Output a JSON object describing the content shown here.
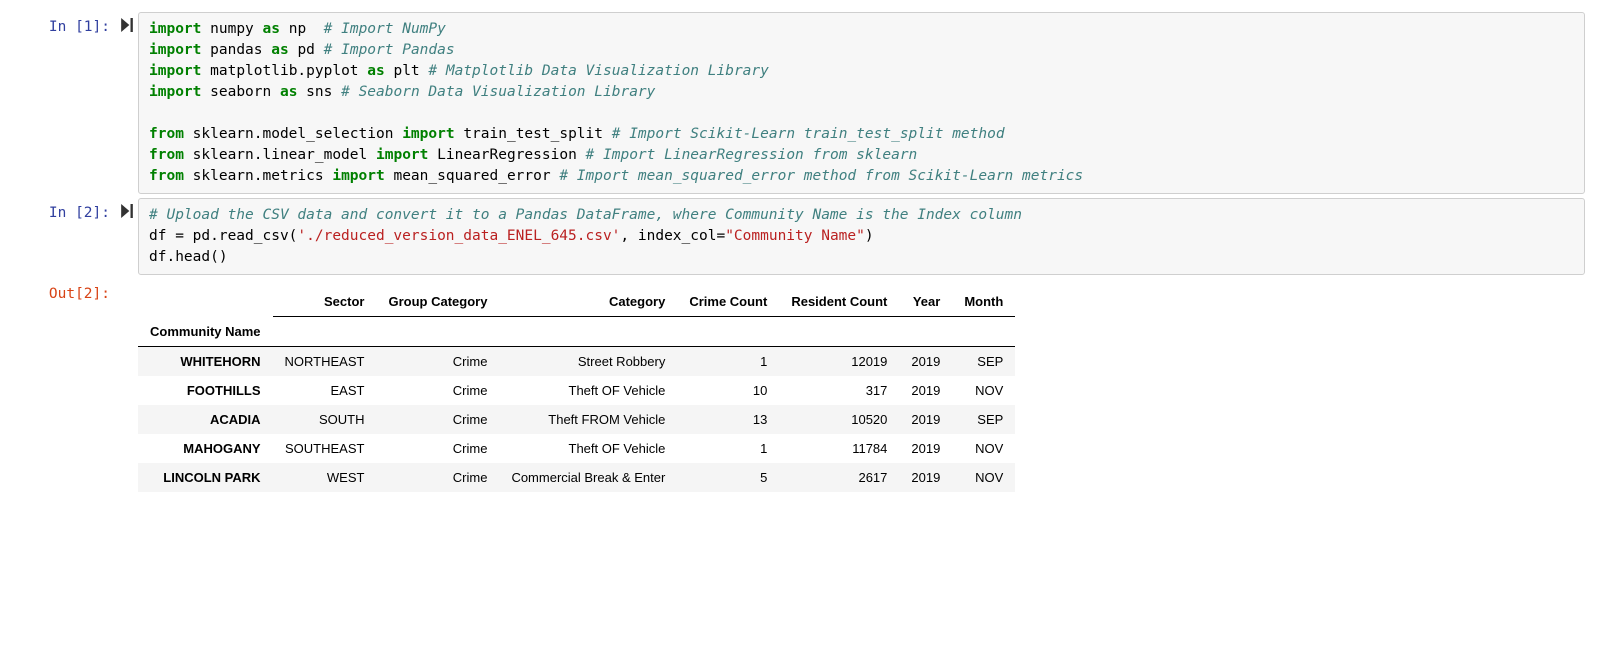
{
  "cells": [
    {
      "prompt_in": "In [1]:",
      "tokens": [
        [
          [
            "kw",
            "import"
          ],
          [
            "sp",
            " "
          ],
          [
            "name",
            "numpy"
          ],
          [
            "sp",
            " "
          ],
          [
            "kw",
            "as"
          ],
          [
            "sp",
            " "
          ],
          [
            "name",
            "np"
          ],
          [
            "sp",
            "  "
          ],
          [
            "cmt",
            "# Import NumPy"
          ]
        ],
        [
          [
            "kw",
            "import"
          ],
          [
            "sp",
            " "
          ],
          [
            "name",
            "pandas"
          ],
          [
            "sp",
            " "
          ],
          [
            "kw",
            "as"
          ],
          [
            "sp",
            " "
          ],
          [
            "name",
            "pd"
          ],
          [
            "sp",
            " "
          ],
          [
            "cmt",
            "# Import Pandas"
          ]
        ],
        [
          [
            "kw",
            "import"
          ],
          [
            "sp",
            " "
          ],
          [
            "name",
            "matplotlib.pyplot"
          ],
          [
            "sp",
            " "
          ],
          [
            "kw",
            "as"
          ],
          [
            "sp",
            " "
          ],
          [
            "name",
            "plt"
          ],
          [
            "sp",
            " "
          ],
          [
            "cmt",
            "# Matplotlib Data Visualization Library"
          ]
        ],
        [
          [
            "kw",
            "import"
          ],
          [
            "sp",
            " "
          ],
          [
            "name",
            "seaborn"
          ],
          [
            "sp",
            " "
          ],
          [
            "kw",
            "as"
          ],
          [
            "sp",
            " "
          ],
          [
            "name",
            "sns"
          ],
          [
            "sp",
            " "
          ],
          [
            "cmt",
            "# Seaborn Data Visualization Library"
          ]
        ],
        [],
        [
          [
            "kw",
            "from"
          ],
          [
            "sp",
            " "
          ],
          [
            "name",
            "sklearn.model_selection"
          ],
          [
            "sp",
            " "
          ],
          [
            "kw",
            "import"
          ],
          [
            "sp",
            " "
          ],
          [
            "name",
            "train_test_split"
          ],
          [
            "sp",
            " "
          ],
          [
            "cmt",
            "# Import Scikit-Learn train_test_split method"
          ]
        ],
        [
          [
            "kw",
            "from"
          ],
          [
            "sp",
            " "
          ],
          [
            "name",
            "sklearn.linear_model"
          ],
          [
            "sp",
            " "
          ],
          [
            "kw",
            "import"
          ],
          [
            "sp",
            " "
          ],
          [
            "name",
            "LinearRegression"
          ],
          [
            "sp",
            " "
          ],
          [
            "cmt",
            "# Import LinearRegression from sklearn"
          ]
        ],
        [
          [
            "kw",
            "from"
          ],
          [
            "sp",
            " "
          ],
          [
            "name",
            "sklearn.metrics"
          ],
          [
            "sp",
            " "
          ],
          [
            "kw",
            "import"
          ],
          [
            "sp",
            " "
          ],
          [
            "name",
            "mean_squared_error"
          ],
          [
            "sp",
            " "
          ],
          [
            "cmt",
            "# Import mean_squared_error method from Scikit-Learn metrics"
          ]
        ]
      ]
    },
    {
      "prompt_in": "In [2]:",
      "prompt_out": "Out[2]:",
      "tokens": [
        [
          [
            "cmt",
            "# Upload the CSV data and convert it to a Pandas DataFrame, where Community Name is the Index column"
          ]
        ],
        [
          [
            "name",
            "df = pd.read_csv("
          ],
          [
            "str",
            "'./reduced_version_data_ENEL_645.csv'"
          ],
          [
            "name",
            ", index_col="
          ],
          [
            "str",
            "\"Community Name\""
          ],
          [
            "name",
            ")"
          ]
        ],
        [
          [
            "name",
            "df.head()"
          ]
        ]
      ],
      "output_table": {
        "index_name": "Community Name",
        "columns": [
          "Sector",
          "Group Category",
          "Category",
          "Crime Count",
          "Resident Count",
          "Year",
          "Month"
        ],
        "rows": [
          {
            "idx": "WHITEHORN",
            "cells": [
              "NORTHEAST",
              "Crime",
              "Street Robbery",
              "1",
              "12019",
              "2019",
              "SEP"
            ]
          },
          {
            "idx": "FOOTHILLS",
            "cells": [
              "EAST",
              "Crime",
              "Theft OF Vehicle",
              "10",
              "317",
              "2019",
              "NOV"
            ]
          },
          {
            "idx": "ACADIA",
            "cells": [
              "SOUTH",
              "Crime",
              "Theft FROM Vehicle",
              "13",
              "10520",
              "2019",
              "SEP"
            ]
          },
          {
            "idx": "MAHOGANY",
            "cells": [
              "SOUTHEAST",
              "Crime",
              "Theft OF Vehicle",
              "1",
              "11784",
              "2019",
              "NOV"
            ]
          },
          {
            "idx": "LINCOLN PARK",
            "cells": [
              "WEST",
              "Crime",
              "Commercial Break & Enter",
              "5",
              "2617",
              "2019",
              "NOV"
            ]
          }
        ]
      }
    }
  ]
}
